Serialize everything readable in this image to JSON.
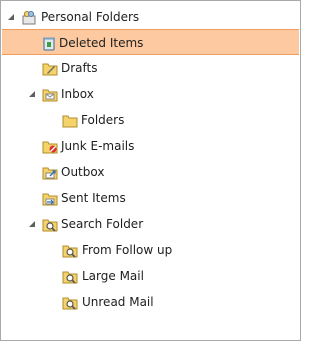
{
  "tree": {
    "root": {
      "label": "Personal Folders",
      "icon": "personal-folders-icon",
      "expanded": true
    },
    "items": [
      {
        "id": "deleted-items",
        "label": "Deleted Items",
        "icon": "trash-can-icon",
        "selected": true
      },
      {
        "id": "drafts",
        "label": "Drafts",
        "icon": "drafts-folder-icon"
      },
      {
        "id": "inbox",
        "label": "Inbox",
        "icon": "inbox-folder-icon",
        "expanded": true
      },
      {
        "id": "folders",
        "label": "Folders",
        "icon": "folder-icon"
      },
      {
        "id": "junk-emails",
        "label": "Junk E-mails",
        "icon": "junk-folder-icon"
      },
      {
        "id": "outbox",
        "label": "Outbox",
        "icon": "outbox-folder-icon"
      },
      {
        "id": "sent-items",
        "label": "Sent Items",
        "icon": "sent-folder-icon"
      },
      {
        "id": "search-folder",
        "label": "Search Folder",
        "icon": "search-folder-icon",
        "expanded": true
      },
      {
        "id": "from-follow-up",
        "label": "From Follow up",
        "icon": "search-folder-icon"
      },
      {
        "id": "large-mail",
        "label": "Large Mail",
        "icon": "search-folder-icon"
      },
      {
        "id": "unread-mail",
        "label": "Unread Mail",
        "icon": "search-folder-icon"
      }
    ]
  },
  "colors": {
    "selected_background": "#fcc9a0",
    "selected_border": "#ee9d5c",
    "folder_yellow": "#f5d36a",
    "border": "#a9a9a9"
  }
}
